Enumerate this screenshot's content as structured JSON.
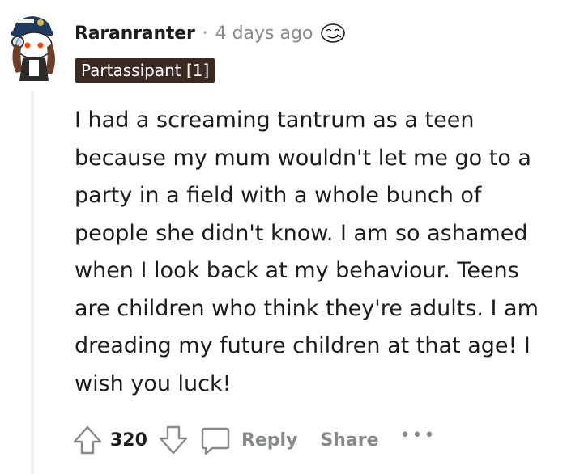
{
  "comment": {
    "username": "Raranranter",
    "separator": "·",
    "timestamp": "4 days ago",
    "flair": "Partassipant [1]",
    "award_icon": "award-face-icon",
    "avatar_icon": "snoo-avatar-captain-icon",
    "body": "I had a screaming tantrum as a teen because my mum wouldn't let me go to a party in a field with a whole bunch of people she didn't know. I am so ashamed when I look back at my behaviour. Teens are children who think they're adults. I am dreading my future children at that age! I wish you luck!"
  },
  "actions": {
    "score": "320",
    "upvote_icon": "upvote-arrow-icon",
    "downvote_icon": "downvote-arrow-icon",
    "reply_icon": "comment-bubble-icon",
    "reply_label": "Reply",
    "share_label": "Share",
    "more_label": "•••"
  },
  "colors": {
    "text": "#1c1c1c",
    "muted": "#878a8c",
    "flair_bg": "#3b2a22",
    "flair_text": "#ffffff",
    "thread_line": "#edeff1"
  }
}
